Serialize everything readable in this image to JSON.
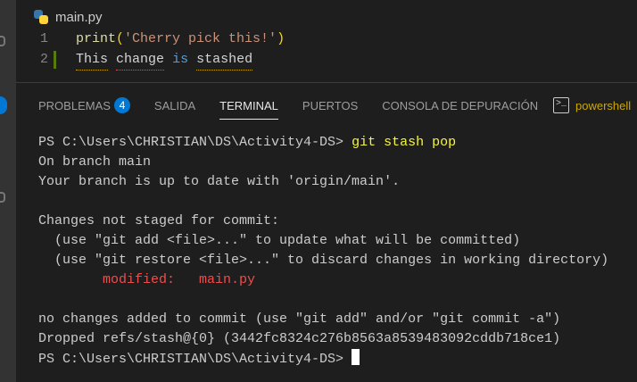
{
  "editor": {
    "filename": "main.py",
    "lines": [
      {
        "num": "1",
        "p1": "print",
        "p2": "(",
        "p3": "'Cherry pick this!'",
        "p4": ")"
      },
      {
        "num": "2",
        "w1": "This",
        "w2": "change",
        "w3": "is",
        "w4": "stashed"
      }
    ]
  },
  "panel": {
    "tabs": [
      "PROBLEMAS",
      "SALIDA",
      "TERMINAL",
      "PUERTOS",
      "CONSOLA DE DEPURACIÓN"
    ],
    "problems_count": "4",
    "shell": "powershell",
    "shell_icon": ">_"
  },
  "terminal": {
    "prompt": "PS C:\\Users\\CHRISTIAN\\DS\\Activity4-DS> ",
    "command": "git stash pop",
    "lines": [
      "On branch main",
      "Your branch is up to date with 'origin/main'.",
      "",
      "Changes not staged for commit:",
      "  (use \"git add <file>...\" to update what will be committed)",
      "  (use \"git restore <file>...\" to discard changes in working directory)"
    ],
    "modified_label": "        modified:   main.py",
    "after": [
      "",
      "no changes added to commit (use \"git add\" and/or \"git commit -a\")",
      "Dropped refs/stash@{0} (3442fc8324c276b8563a8539483092cddb718ce1)"
    ],
    "final_prompt": "PS C:\\Users\\CHRISTIAN\\DS\\Activity4-DS> "
  }
}
